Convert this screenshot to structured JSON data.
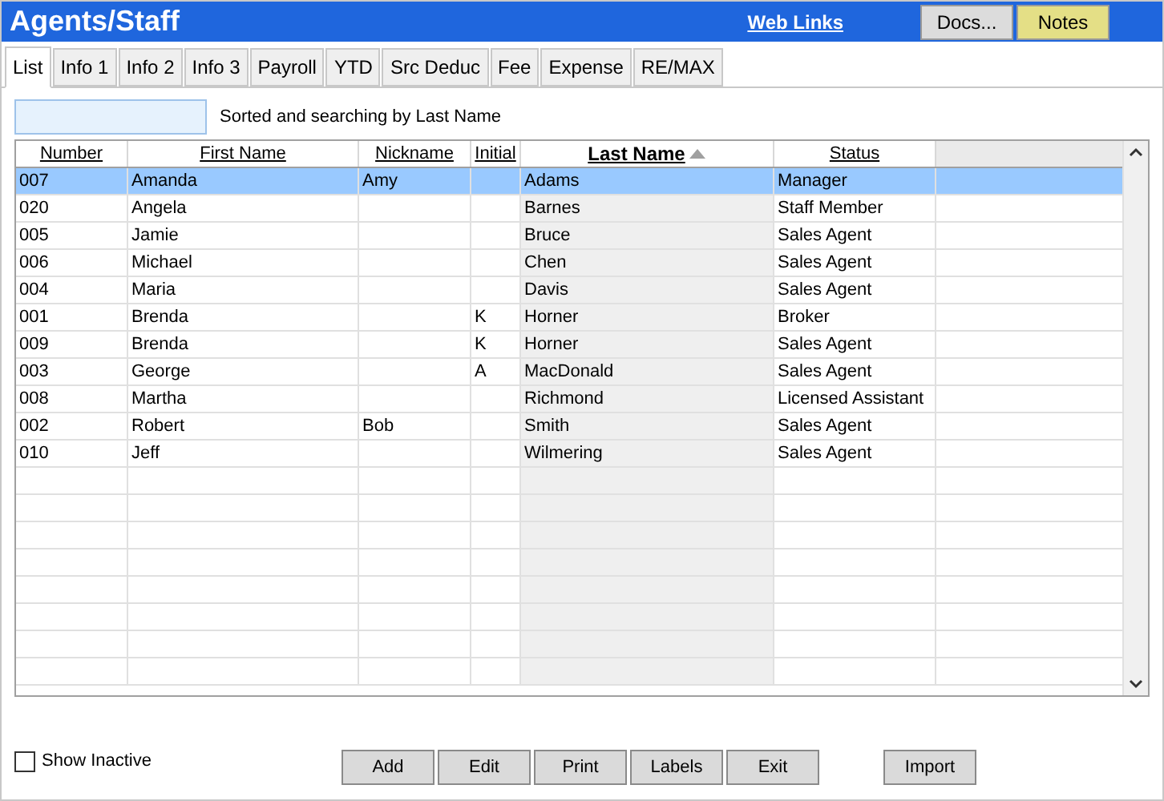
{
  "window": {
    "title": "Agents/Staff"
  },
  "header_links": [
    {
      "label": "Web Links"
    }
  ],
  "header_buttons": [
    {
      "label": "Docs...",
      "kind": "plain"
    },
    {
      "label": "Notes",
      "kind": "highlight"
    }
  ],
  "tabs": [
    {
      "label": "List",
      "selected": true
    },
    {
      "label": "Info 1",
      "selected": false
    },
    {
      "label": "Info 2",
      "selected": false
    },
    {
      "label": "Info 3",
      "selected": false
    },
    {
      "label": "Payroll",
      "selected": false
    },
    {
      "label": "YTD",
      "selected": false
    },
    {
      "label": "Src Deduc",
      "selected": false
    },
    {
      "label": "Fee",
      "selected": false
    },
    {
      "label": "Expense",
      "selected": false
    },
    {
      "label": "RE/MAX",
      "selected": false
    }
  ],
  "search": {
    "hint": "Sorted and searching by Last Name"
  },
  "table": {
    "columns": [
      {
        "label": "Number",
        "sorted": false
      },
      {
        "label": "First Name",
        "sorted": false
      },
      {
        "label": "Nickname",
        "sorted": false
      },
      {
        "label": "Initial",
        "sorted": false
      },
      {
        "label": "Last Name",
        "sorted": true
      },
      {
        "label": "Status",
        "sorted": false
      }
    ],
    "rows": [
      {
        "selected": true,
        "cells": [
          "007",
          "Amanda",
          "Amy",
          "",
          "Adams",
          "Manager"
        ]
      },
      {
        "selected": false,
        "cells": [
          "020",
          "Angela",
          "",
          "",
          "Barnes",
          "Staff Member"
        ]
      },
      {
        "selected": false,
        "cells": [
          "005",
          "Jamie",
          "",
          "",
          "Bruce",
          "Sales Agent"
        ]
      },
      {
        "selected": false,
        "cells": [
          "006",
          "Michael",
          "",
          "",
          "Chen",
          "Sales Agent"
        ]
      },
      {
        "selected": false,
        "cells": [
          "004",
          "Maria",
          "",
          "",
          "Davis",
          "Sales Agent"
        ]
      },
      {
        "selected": false,
        "cells": [
          "001",
          "Brenda",
          "",
          "K",
          "Horner",
          "Broker"
        ]
      },
      {
        "selected": false,
        "cells": [
          "009",
          "Brenda",
          "",
          "K",
          "Horner",
          "Sales Agent"
        ]
      },
      {
        "selected": false,
        "cells": [
          "003",
          "George",
          "",
          "A",
          "MacDonald",
          "Sales Agent"
        ]
      },
      {
        "selected": false,
        "cells": [
          "008",
          "Martha",
          "",
          "",
          "Richmond",
          "Licensed Assistant"
        ]
      },
      {
        "selected": false,
        "cells": [
          "002",
          "Robert",
          "Bob",
          "",
          "Smith",
          "Sales Agent"
        ]
      },
      {
        "selected": false,
        "cells": [
          "010",
          "Jeff",
          "",
          "",
          "Wilmering",
          "Sales Agent"
        ]
      }
    ]
  },
  "show_inactive": {
    "label": "Show Inactive",
    "checked": false
  },
  "buttons": [
    {
      "label": "Add"
    },
    {
      "label": "Edit"
    },
    {
      "label": "Print"
    },
    {
      "label": "Labels"
    },
    {
      "label": "Exit"
    }
  ],
  "side_buttons": [
    {
      "label": "Import"
    }
  ]
}
